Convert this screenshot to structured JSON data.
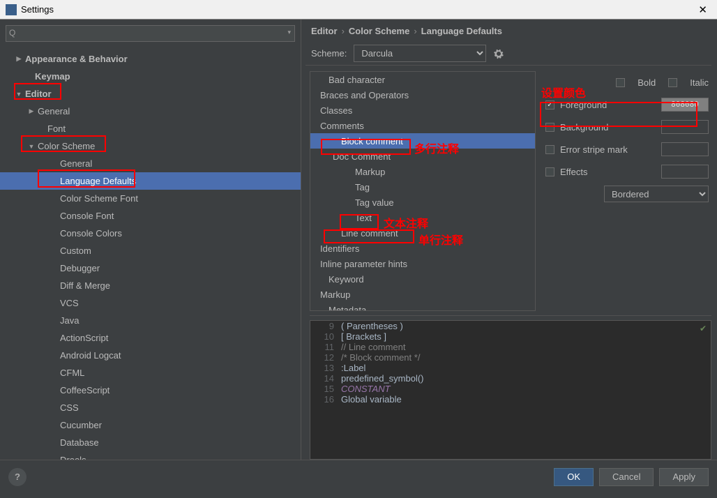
{
  "window": {
    "title": "Settings"
  },
  "breadcrumbs": [
    "Editor",
    "Color Scheme",
    "Language Defaults"
  ],
  "scheme": {
    "label": "Scheme:",
    "value": "Darcula"
  },
  "left_tree": [
    {
      "label": "Appearance & Behavior",
      "indent": 22,
      "tri": "closed",
      "bold": true
    },
    {
      "label": "Keymap",
      "indent": 36,
      "tri": "none",
      "bold": true
    },
    {
      "label": "Editor",
      "indent": 22,
      "tri": "open",
      "bold": true
    },
    {
      "label": "General",
      "indent": 40,
      "tri": "closed",
      "bold": false
    },
    {
      "label": "Font",
      "indent": 54,
      "tri": "none",
      "bold": false
    },
    {
      "label": "Color Scheme",
      "indent": 40,
      "tri": "open",
      "bold": false
    },
    {
      "label": "General",
      "indent": 72,
      "tri": "none",
      "bold": false
    },
    {
      "label": "Language Defaults",
      "indent": 72,
      "tri": "none",
      "bold": false,
      "selected": true
    },
    {
      "label": "Color Scheme Font",
      "indent": 72,
      "tri": "none",
      "bold": false
    },
    {
      "label": "Console Font",
      "indent": 72,
      "tri": "none",
      "bold": false
    },
    {
      "label": "Console Colors",
      "indent": 72,
      "tri": "none",
      "bold": false
    },
    {
      "label": "Custom",
      "indent": 72,
      "tri": "none",
      "bold": false
    },
    {
      "label": "Debugger",
      "indent": 72,
      "tri": "none",
      "bold": false
    },
    {
      "label": "Diff & Merge",
      "indent": 72,
      "tri": "none",
      "bold": false
    },
    {
      "label": "VCS",
      "indent": 72,
      "tri": "none",
      "bold": false
    },
    {
      "label": "Java",
      "indent": 72,
      "tri": "none",
      "bold": false
    },
    {
      "label": "ActionScript",
      "indent": 72,
      "tri": "none",
      "bold": false
    },
    {
      "label": "Android Logcat",
      "indent": 72,
      "tri": "none",
      "bold": false
    },
    {
      "label": "CFML",
      "indent": 72,
      "tri": "none",
      "bold": false
    },
    {
      "label": "CoffeeScript",
      "indent": 72,
      "tri": "none",
      "bold": false
    },
    {
      "label": "CSS",
      "indent": 72,
      "tri": "none",
      "bold": false
    },
    {
      "label": "Cucumber",
      "indent": 72,
      "tri": "none",
      "bold": false
    },
    {
      "label": "Database",
      "indent": 72,
      "tri": "none",
      "bold": false
    },
    {
      "label": "Drools",
      "indent": 72,
      "tri": "none",
      "bold": false
    }
  ],
  "attr_tree": [
    {
      "label": "Bad character",
      "indent": 18,
      "tri": "none"
    },
    {
      "label": "Braces and Operators",
      "indent": 6,
      "tri": "closed"
    },
    {
      "label": "Classes",
      "indent": 6,
      "tri": "closed"
    },
    {
      "label": "Comments",
      "indent": 6,
      "tri": "open"
    },
    {
      "label": "Block comment",
      "indent": 36,
      "tri": "none",
      "selected": true
    },
    {
      "label": "Doc Comment",
      "indent": 24,
      "tri": "open"
    },
    {
      "label": "Markup",
      "indent": 56,
      "tri": "none"
    },
    {
      "label": "Tag",
      "indent": 56,
      "tri": "none"
    },
    {
      "label": "Tag value",
      "indent": 56,
      "tri": "none"
    },
    {
      "label": "Text",
      "indent": 56,
      "tri": "none"
    },
    {
      "label": "Line comment",
      "indent": 36,
      "tri": "none"
    },
    {
      "label": "Identifiers",
      "indent": 6,
      "tri": "closed"
    },
    {
      "label": "Inline parameter hints",
      "indent": 6,
      "tri": "closed"
    },
    {
      "label": "Keyword",
      "indent": 18,
      "tri": "none"
    },
    {
      "label": "Markup",
      "indent": 6,
      "tri": "closed"
    },
    {
      "label": "Metadata",
      "indent": 18,
      "tri": "none"
    }
  ],
  "props": {
    "bold": "Bold",
    "italic": "Italic",
    "foreground": "Foreground",
    "foreground_value": "808080",
    "background": "Background",
    "error_stripe": "Error stripe mark",
    "effects": "Effects",
    "effects_type": "Bordered"
  },
  "preview": [
    {
      "n": "9",
      "raw": "( Parentheses )",
      "color": "#a9b7c6"
    },
    {
      "n": "10",
      "raw": "[ Brackets ]",
      "color": "#a9b7c6"
    },
    {
      "n": "11",
      "raw": "// Line comment",
      "color": "#808080"
    },
    {
      "n": "12",
      "raw": "/* Block comment */",
      "color": "#808080"
    },
    {
      "n": "13",
      "raw": ":Label",
      "color": "#a9b7c6"
    },
    {
      "n": "14",
      "raw": "predefined_symbol()",
      "color": "#a9b7c6"
    },
    {
      "n": "15",
      "raw": "CONSTANT",
      "color": "#9876aa",
      "italic": true
    },
    {
      "n": "16",
      "raw": "Global variable",
      "color": "#a9b7c6"
    }
  ],
  "footer": {
    "ok": "OK",
    "cancel": "Cancel",
    "apply": "Apply"
  },
  "annotations": {
    "set_color": "设置颜色",
    "multiline": "多行注释",
    "text": "文本注释",
    "singleline": "单行注释"
  }
}
